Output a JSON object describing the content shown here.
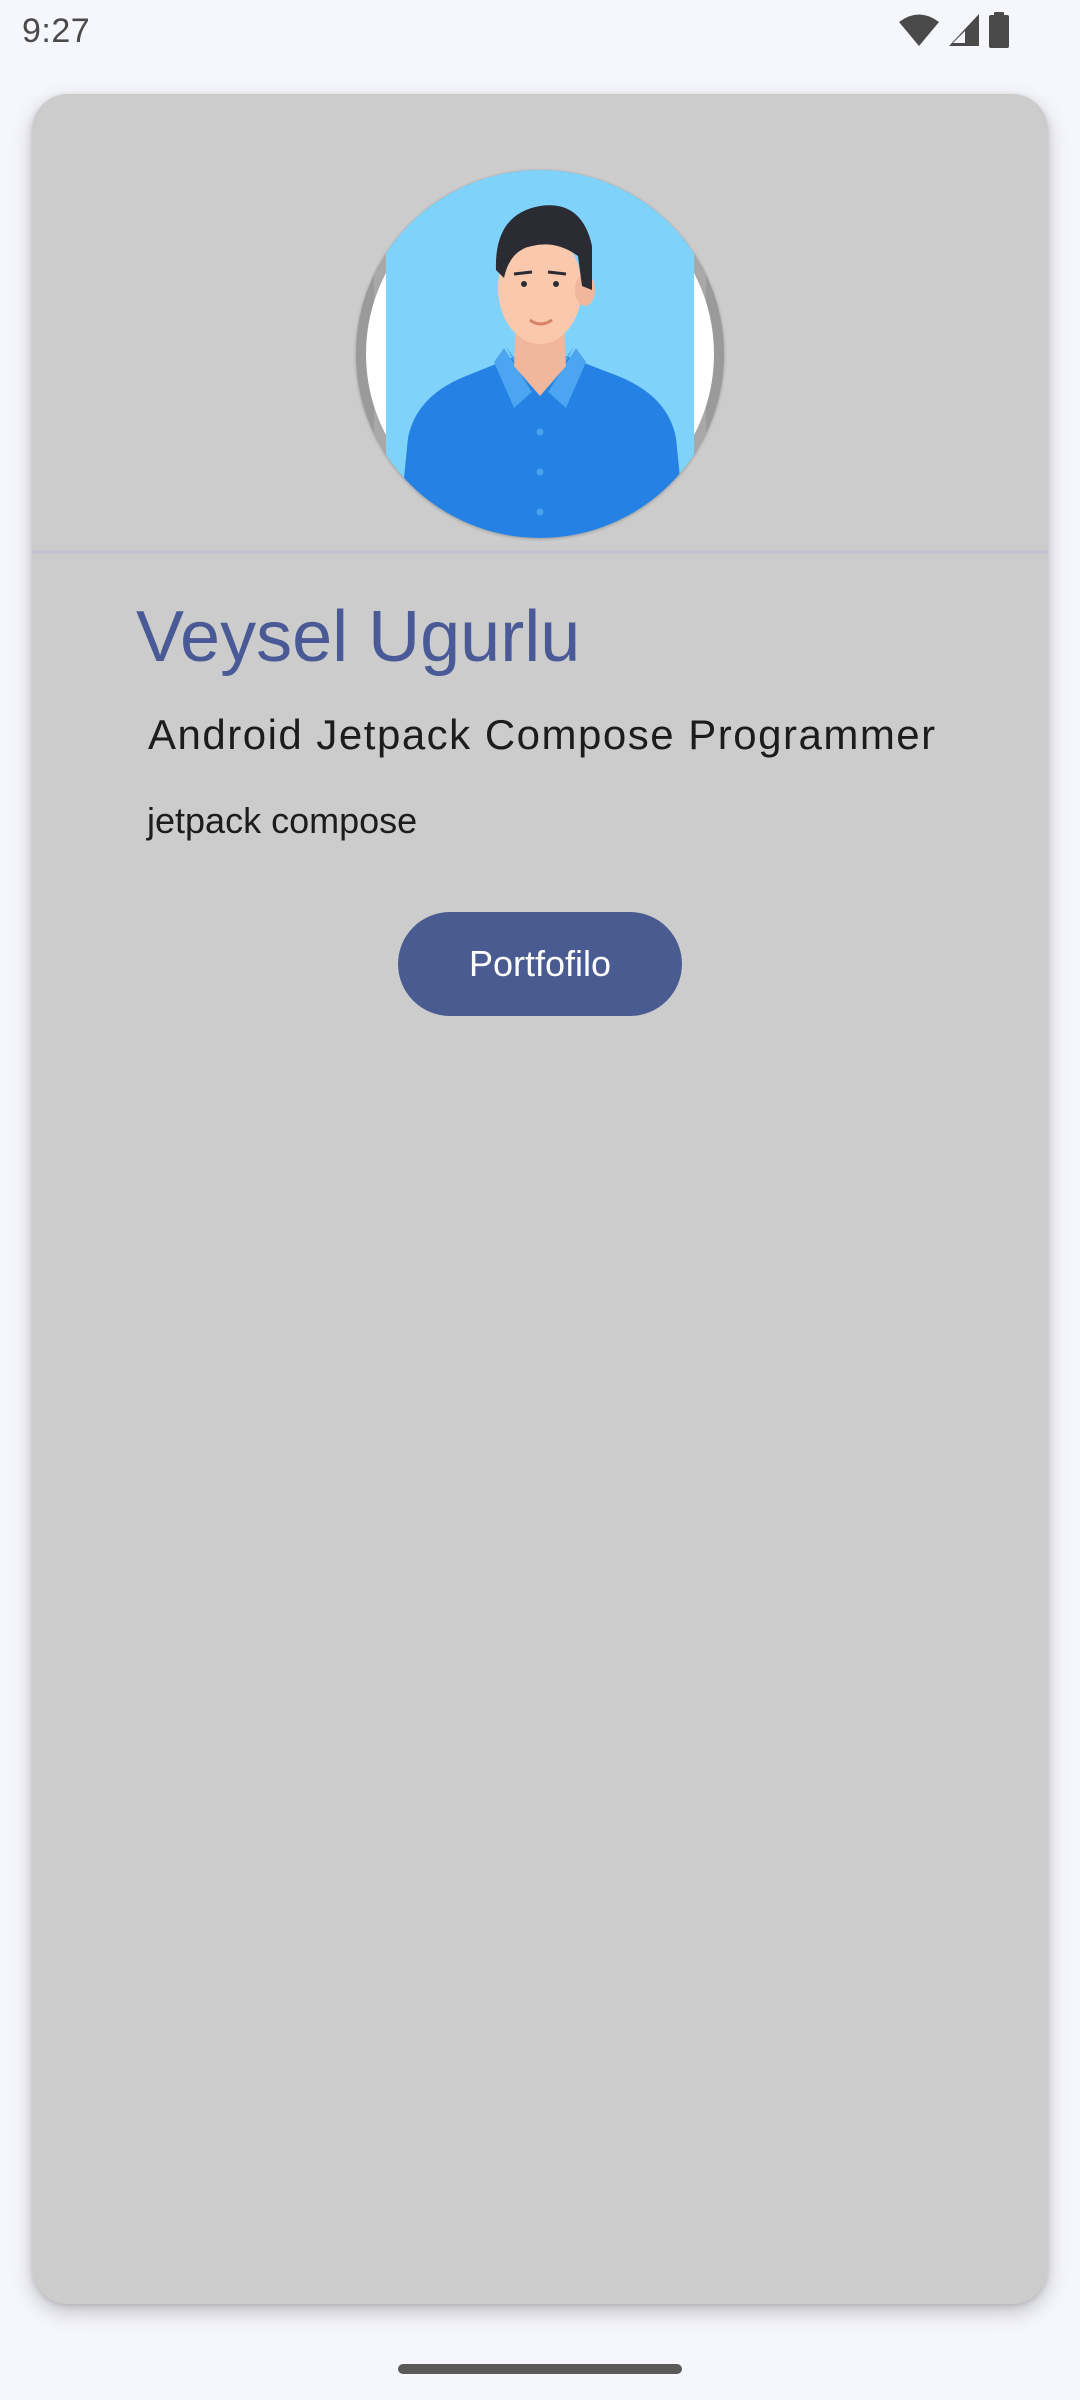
{
  "status_bar": {
    "time": "9:27",
    "icons": [
      "wifi-icon",
      "cell-signal-icon",
      "battery-icon"
    ]
  },
  "profile": {
    "name": "Veysel Ugurlu",
    "title": "Android Jetpack Compose Programmer",
    "tagline": "jetpack compose",
    "portfolio_button_label": "Portfofilo",
    "avatar": "avatar-illustration"
  },
  "colors": {
    "background": "#f6f7fc",
    "card": "#cccccc",
    "name_text": "#4a5a96",
    "button": "#4a5b92",
    "button_text": "#ffffff"
  }
}
